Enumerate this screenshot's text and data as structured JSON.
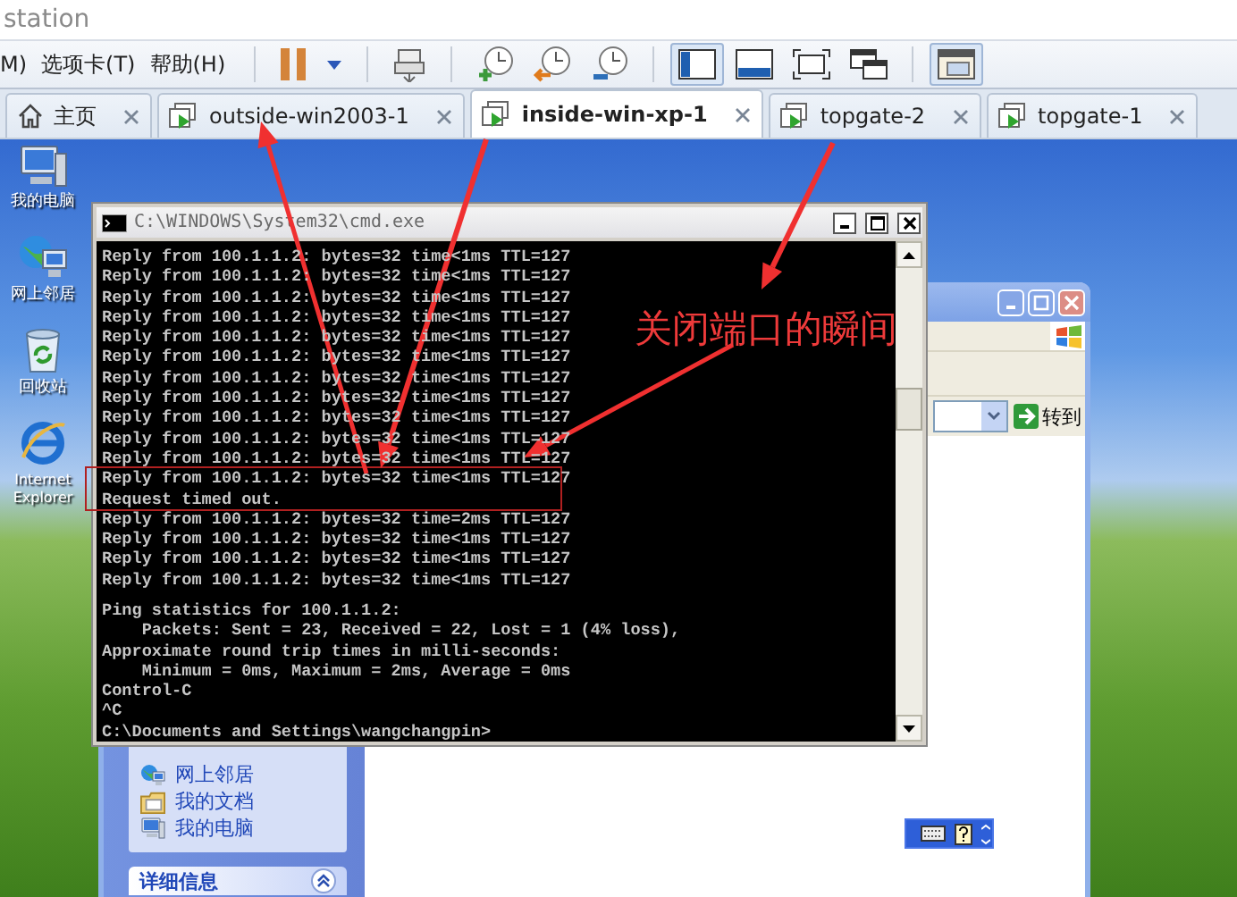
{
  "window": {
    "title": "station"
  },
  "menu": [
    {
      "label": "M)"
    },
    {
      "label": "选项卡(T)"
    },
    {
      "label": "帮助(H)"
    }
  ],
  "toolbar": [
    {
      "kind": "pause",
      "selected": false
    },
    {
      "kind": "dropdown",
      "selected": false
    },
    {
      "kind": "send-keys",
      "selected": false
    },
    {
      "kind": "snapshot-take",
      "selected": false
    },
    {
      "kind": "snapshot-revert",
      "selected": false
    },
    {
      "kind": "snapshot-manage",
      "selected": false
    },
    {
      "kind": "view-sidebar",
      "selected": true
    },
    {
      "kind": "view-console",
      "selected": false
    },
    {
      "kind": "view-fullscreen",
      "selected": false
    },
    {
      "kind": "view-unity",
      "selected": false
    },
    {
      "kind": "view-thumbnail",
      "selected": true
    }
  ],
  "tabs": [
    {
      "kind": "home",
      "label": "主页",
      "selected": false
    },
    {
      "kind": "vm",
      "label": "outside-win2003-1",
      "selected": false
    },
    {
      "kind": "vm",
      "label": "inside-win-xp-1",
      "selected": true
    },
    {
      "kind": "vm",
      "label": "topgate-2",
      "selected": false
    },
    {
      "kind": "vm",
      "label": "topgate-1",
      "selected": false
    }
  ],
  "desktop_icons": [
    {
      "kind": "computer",
      "label": "我的电脑"
    },
    {
      "kind": "network",
      "label": "网上邻居"
    },
    {
      "kind": "recycle",
      "label": "回收站"
    },
    {
      "kind": "browser",
      "label": "Internet Explorer"
    }
  ],
  "explorer": {
    "go_button": "转到",
    "tasks": [
      {
        "kind": "network",
        "label": "网上邻居"
      },
      {
        "kind": "documents",
        "label": "我的文档"
      },
      {
        "kind": "computer",
        "label": "我的电脑"
      }
    ],
    "details_header": "详细信息"
  },
  "cmd": {
    "title": "C:\\WINDOWS\\System32\\cmd.exe",
    "output": [
      "Reply from 100.1.1.2: bytes=32 time<1ms TTL=127",
      "Reply from 100.1.1.2: bytes=32 time<1ms TTL=127",
      "Reply from 100.1.1.2: bytes=32 time<1ms TTL=127",
      "Reply from 100.1.1.2: bytes=32 time<1ms TTL=127",
      "Reply from 100.1.1.2: bytes=32 time<1ms TTL=127",
      "Reply from 100.1.1.2: bytes=32 time<1ms TTL=127",
      "Reply from 100.1.1.2: bytes=32 time<1ms TTL=127",
      "Reply from 100.1.1.2: bytes=32 time<1ms TTL=127",
      "Reply from 100.1.1.2: bytes=32 time<1ms TTL=127",
      "Reply from 100.1.1.2: bytes=32 time<1ms TTL=127",
      "Reply from 100.1.1.2: bytes=32 time<1ms TTL=127",
      "Reply from 100.1.1.2: bytes=32 time<1ms TTL=127",
      "Request timed out.",
      "Reply from 100.1.1.2: bytes=32 time=2ms TTL=127",
      "Reply from 100.1.1.2: bytes=32 time<1ms TTL=127",
      "Reply from 100.1.1.2: bytes=32 time<1ms TTL=127",
      "Reply from 100.1.1.2: bytes=32 time<1ms TTL=127"
    ],
    "summary": [
      "Ping statistics for 100.1.1.2:",
      "    Packets: Sent = 23, Received = 22, Lost = 1 (4% loss),",
      "Approximate round trip times in milli-seconds:",
      "    Minimum = 0ms, Maximum = 2ms, Average = 0ms",
      "Control-C",
      "^C",
      "C:\\Documents and Settings\\wangchangpin>"
    ]
  },
  "annotation": {
    "text": "关闭端口的瞬间"
  }
}
